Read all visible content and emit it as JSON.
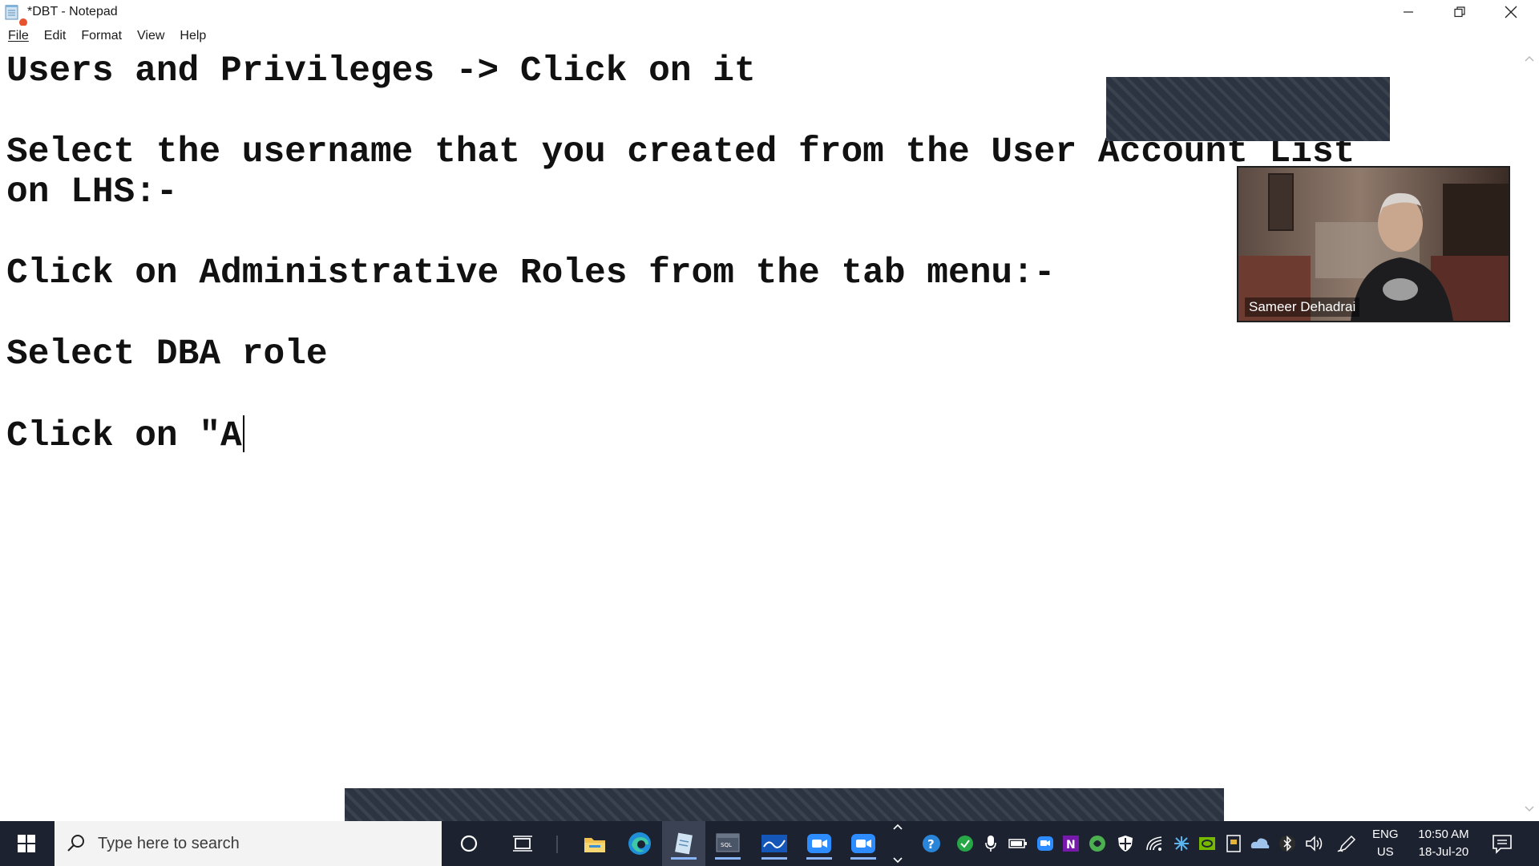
{
  "window": {
    "title": "*DBT - Notepad"
  },
  "menu": {
    "items": [
      "File",
      "Edit",
      "Format",
      "View",
      "Help"
    ]
  },
  "editor": {
    "lines": [
      "Users and Privileges -> Click on it",
      "",
      "Select the username that you created from the User Account List",
      "on LHS:-",
      "",
      "Click on Administrative Roles from the tab menu:-",
      "",
      "Select DBA role",
      "",
      "Click on \"A"
    ]
  },
  "webcam": {
    "participant_name": "Sameer Dehadrai"
  },
  "taskbar": {
    "search_placeholder": "Type here to search",
    "pinned_apps": [
      "cortana-icon",
      "task-view-icon",
      "file-explorer-icon",
      "edge-icon",
      "notepad-icon",
      "sql-developer-icon",
      "whiteboard-icon",
      "zoom-meetings-icon",
      "zoom-icon"
    ],
    "language_line1": "ENG",
    "language_line2": "US",
    "time": "10:50 AM",
    "date": "18-Jul-20"
  },
  "colors": {
    "taskbar_bg": "#1c2230",
    "redaction": "#2b3440",
    "text": "#111111"
  }
}
